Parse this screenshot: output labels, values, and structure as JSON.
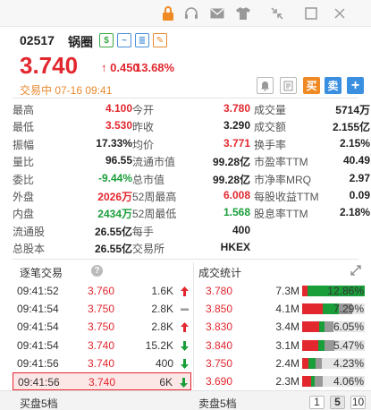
{
  "toolbar": {
    "icons": [
      "lock-icon",
      "headset-icon",
      "mail-icon",
      "shirt-icon",
      "collapse-icon",
      "window-icon",
      "close-icon"
    ]
  },
  "stock": {
    "code": "02517",
    "name": "锅圈",
    "tag_buttons": [
      "$",
      "~",
      "≣",
      "✎"
    ],
    "price": "3.740",
    "change_arrow": "↑",
    "change": "0.450",
    "change_pct": "13.68%",
    "status": "交易中 07-16 09:41"
  },
  "actions": {
    "bell": "bell-icon",
    "news": "news-icon",
    "buy": "买",
    "sell": "卖",
    "add": "+"
  },
  "quote": [
    [
      {
        "l": "最高",
        "v": "4.100",
        "c": "red"
      },
      {
        "l": "今开",
        "v": "3.780",
        "c": "red"
      },
      {
        "l": "成交量",
        "v": "5714万",
        "c": "dark"
      }
    ],
    [
      {
        "l": "最低",
        "v": "3.530",
        "c": "red"
      },
      {
        "l": "昨收",
        "v": "3.290",
        "c": "dark"
      },
      {
        "l": "成交额",
        "v": "2.155亿",
        "c": "dark"
      }
    ],
    [
      {
        "l": "振幅",
        "v": "17.33%",
        "c": "dark"
      },
      {
        "l": "均价",
        "v": "3.771",
        "c": "red"
      },
      {
        "l": "换手率",
        "v": "2.15%",
        "c": "dark"
      }
    ],
    [
      {
        "l": "量比",
        "v": "96.55",
        "c": "dark"
      },
      {
        "l": "流通市值",
        "v": "99.28亿",
        "c": "dark"
      },
      {
        "l": "市盈率TTM",
        "v": "40.49",
        "c": "dark"
      }
    ],
    [
      {
        "l": "委比",
        "v": "-9.44%",
        "c": "green"
      },
      {
        "l": "总市值",
        "v": "99.28亿",
        "c": "dark"
      },
      {
        "l": "市净率MRQ",
        "v": "2.97",
        "c": "dark"
      }
    ],
    [
      {
        "l": "外盘",
        "v": "2026万",
        "c": "red"
      },
      {
        "l": "52周最高",
        "v": "6.008",
        "c": "red"
      },
      {
        "l": "每股收益TTM",
        "v": "0.09",
        "c": "dark"
      }
    ],
    [
      {
        "l": "内盘",
        "v": "2434万",
        "c": "green"
      },
      {
        "l": "52周最低",
        "v": "1.568",
        "c": "green"
      },
      {
        "l": "股息率TTM",
        "v": "2.18%",
        "c": "dark"
      }
    ],
    [
      {
        "l": "流通股",
        "v": "26.55亿",
        "c": "dark"
      },
      {
        "l": "每手",
        "v": "400",
        "c": "dark"
      },
      {
        "l": "",
        "v": "",
        "c": "dark"
      }
    ],
    [
      {
        "l": "总股本",
        "v": "26.55亿",
        "c": "dark"
      },
      {
        "l": "交易所",
        "v": "HKEX",
        "c": "dark"
      },
      {
        "l": "",
        "v": "",
        "c": "dark"
      }
    ]
  ],
  "trades_title": "逐笔交易",
  "stats_title": "成交统计",
  "trades": [
    {
      "time": "09:41:52",
      "price": "3.760",
      "vol": "1.6K",
      "dir": "up"
    },
    {
      "time": "09:41:54",
      "price": "3.750",
      "vol": "2.8K",
      "dir": "flat"
    },
    {
      "time": "09:41:54",
      "price": "3.750",
      "vol": "2.8K",
      "dir": "up"
    },
    {
      "time": "09:41:54",
      "price": "3.740",
      "vol": "15.2K",
      "dir": "down"
    },
    {
      "time": "09:41:56",
      "price": "3.740",
      "vol": "400",
      "dir": "down"
    },
    {
      "time": "09:41:56",
      "price": "3.740",
      "vol": "6K",
      "dir": "down"
    }
  ],
  "stats": [
    {
      "price": "3.780",
      "vol": "7.3M",
      "pct": "12.86%",
      "red": 0.09,
      "green": 0.91,
      "gray": 0.0
    },
    {
      "price": "3.850",
      "vol": "4.1M",
      "pct": "7.29%",
      "red": 0.33,
      "green": 0.25,
      "gray": 0.22
    },
    {
      "price": "3.830",
      "vol": "3.4M",
      "pct": "6.05%",
      "red": 0.27,
      "green": 0.08,
      "gray": 0.14
    },
    {
      "price": "3.840",
      "vol": "3.1M",
      "pct": "5.47%",
      "red": 0.25,
      "green": 0.1,
      "gray": 0.15
    },
    {
      "price": "3.750",
      "vol": "2.4M",
      "pct": "4.23%",
      "red": 0.1,
      "green": 0.12,
      "gray": 0.1
    },
    {
      "price": "3.690",
      "vol": "2.3M",
      "pct": "4.06%",
      "red": 0.14,
      "green": 0.06,
      "gray": 0.13
    }
  ],
  "bottom": {
    "buy_label": "买盘5档",
    "sell_label": "卖盘5档",
    "pages": [
      "1",
      "5",
      "10"
    ],
    "active_page": "5"
  },
  "colors": {
    "up": "#e2272e",
    "down": "#1a9e3a",
    "gray": "#999999",
    "bar_bg": "#e5e5e5"
  }
}
